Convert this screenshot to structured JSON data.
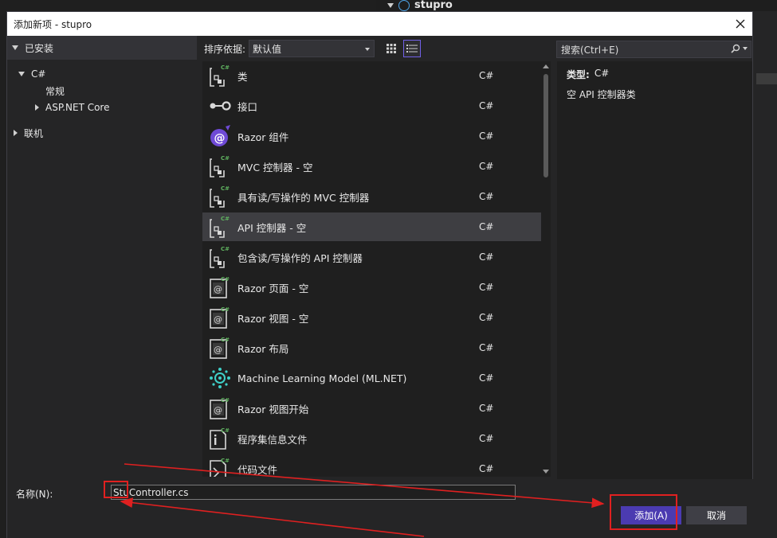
{
  "background": {
    "project_name": "stupro"
  },
  "dialog": {
    "title": "添加新项 - stupro",
    "close_label": "×"
  },
  "left_pane": {
    "installed_label": "已安装",
    "tree": {
      "csharp": "C#",
      "general": "常规",
      "aspnet_core": "ASP.NET Core",
      "online": "联机"
    }
  },
  "toolbar": {
    "sort_label": "排序依据:",
    "sort_value": "默认值"
  },
  "templates": [
    {
      "name": "类",
      "lang": "C#",
      "icon": "class-icon"
    },
    {
      "name": "接口",
      "lang": "C#",
      "icon": "interface-icon"
    },
    {
      "name": "Razor 组件",
      "lang": "C#",
      "icon": "razor-component-icon"
    },
    {
      "name": "MVC 控制器 - 空",
      "lang": "C#",
      "icon": "class-icon"
    },
    {
      "name": "具有读/写操作的 MVC 控制器",
      "lang": "C#",
      "icon": "class-icon"
    },
    {
      "name": "API 控制器 - 空",
      "lang": "C#",
      "icon": "class-icon",
      "selected": true
    },
    {
      "name": "包含读/写操作的 API 控制器",
      "lang": "C#",
      "icon": "class-icon"
    },
    {
      "name": "Razor 页面 - 空",
      "lang": "C#",
      "icon": "razor-page-icon"
    },
    {
      "name": "Razor 视图 - 空",
      "lang": "C#",
      "icon": "razor-page-icon"
    },
    {
      "name": "Razor 布局",
      "lang": "C#",
      "icon": "razor-page-icon"
    },
    {
      "name": "Machine Learning Model (ML.NET)",
      "lang": "C#",
      "icon": "ml-model-icon"
    },
    {
      "name": "Razor 视图开始",
      "lang": "C#",
      "icon": "razor-page-icon"
    },
    {
      "name": "程序集信息文件",
      "lang": "C#",
      "icon": "info-file-icon"
    },
    {
      "name": "代码文件",
      "lang": "C#",
      "icon": "code-file-icon"
    }
  ],
  "search": {
    "placeholder": "搜索(Ctrl+E)"
  },
  "details": {
    "type_label": "类型:",
    "type_value": "C#",
    "description": "空 API 控制器类"
  },
  "bottom": {
    "name_label": "名称(N):",
    "name_value": "StuController.cs",
    "add_label": "添加(A)",
    "cancel_label": "取消"
  },
  "colors": {
    "accent": "#4b3bb1",
    "annotation": "#e02020",
    "csharp_badge": "#5fb25f"
  }
}
